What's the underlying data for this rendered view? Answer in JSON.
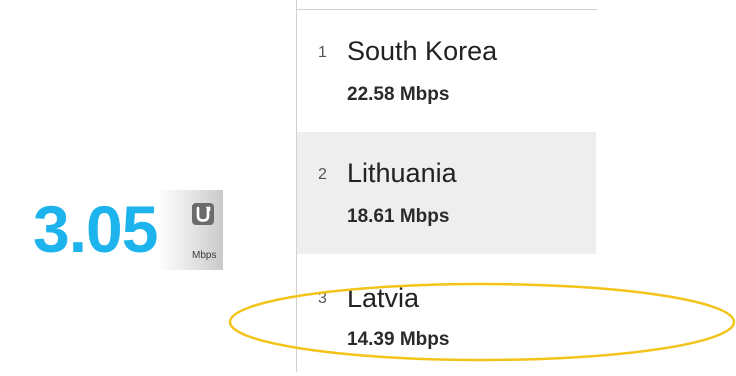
{
  "speed_widget": {
    "value": "3.05",
    "unit": "Mbps",
    "logo_icon": "speedtest-u-icon",
    "value_color": "#1db3ec"
  },
  "ranking": {
    "items": [
      {
        "rank": "1",
        "country": "South Korea",
        "speed": "22.58 Mbps"
      },
      {
        "rank": "2",
        "country": "Lithuania",
        "speed": "18.61 Mbps"
      },
      {
        "rank": "3",
        "country": "Latvia",
        "speed": "14.39 Mbps"
      }
    ],
    "shaded_row_color": "#eeeeee"
  },
  "highlight": {
    "color": "#f2c41a",
    "target": "Latvia"
  }
}
